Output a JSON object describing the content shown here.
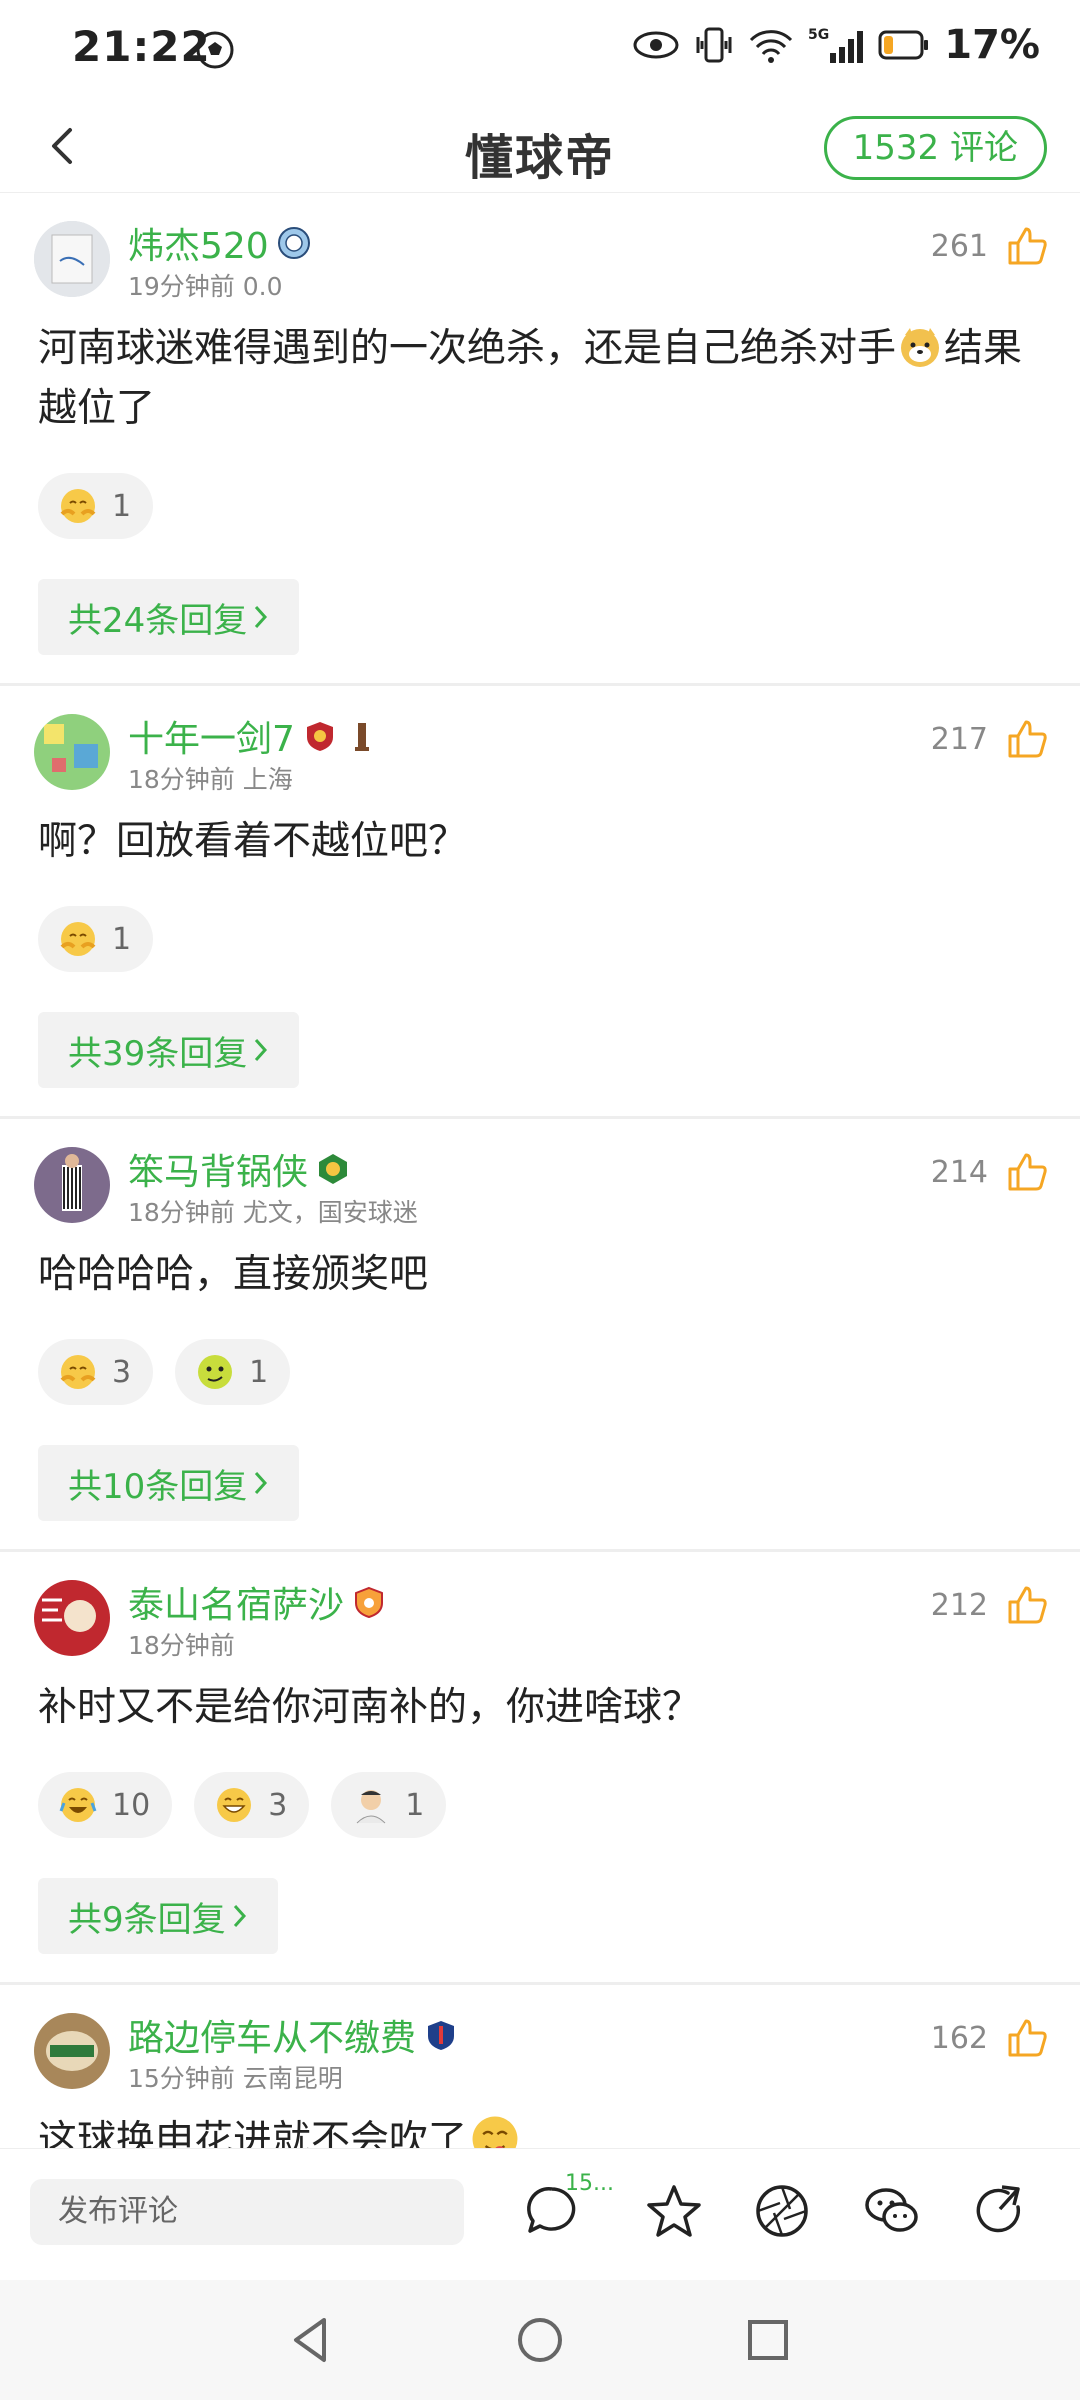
{
  "status_bar": {
    "time": "21:22",
    "network": "5G",
    "battery": "17%"
  },
  "top_bar": {
    "title": "懂球帝",
    "comment_count": "1532 评论"
  },
  "comments": [
    {
      "username": "炜杰520",
      "meta": "19分钟前 0.0",
      "likes": "261",
      "text": "河南球迷难得遇到的一次绝杀，还是自己绝杀对手",
      "text_tail": "结果越位了",
      "reactions": [
        {
          "icon": "hug-emoji",
          "count": "1"
        }
      ],
      "reply_label": "共24条回复",
      "avatar_color": "#d9dde2",
      "badge_icon": "manchester-city-badge"
    },
    {
      "username": "十年一剑7",
      "meta": "18分钟前 上海",
      "likes": "217",
      "text": "啊？回放看着不越位吧？",
      "reactions": [
        {
          "icon": "hug-emoji",
          "count": "1"
        }
      ],
      "reply_label": "共39条回复",
      "avatar_color": "#7cc46b",
      "badge_icon": "club-shield-badge"
    },
    {
      "username": "笨马背锅侠",
      "meta": "18分钟前 尤文，国安球迷",
      "likes": "214",
      "text": "哈哈哈哈，直接颁奖吧",
      "reactions": [
        {
          "icon": "hug-emoji",
          "count": "3"
        },
        {
          "icon": "smirk-emoji",
          "count": "1"
        }
      ],
      "reply_label": "共10条回复",
      "avatar_color": "#6b5b7a",
      "badge_icon": "guoan-badge"
    },
    {
      "username": "泰山名宿萨沙",
      "meta": "18分钟前",
      "likes": "212",
      "text": "补时又不是给你河南补的，你进啥球？",
      "reactions": [
        {
          "icon": "laugh-cry-emoji",
          "count": "10"
        },
        {
          "icon": "joy-emoji",
          "count": "3"
        },
        {
          "icon": "person-emoji",
          "count": "1"
        }
      ],
      "reply_label": "共9条回复",
      "avatar_color": "#c0282f",
      "badge_icon": "taishan-badge"
    },
    {
      "username": "路边停车从不缴费",
      "meta": "15分钟前 云南昆明",
      "likes": "162",
      "text": "这球换申花进就不会吹了",
      "reactions": [],
      "reply_label": "",
      "avatar_color": "#9a7b52",
      "badge_icon": "shenhua-badge"
    }
  ],
  "bottom_bar": {
    "input_placeholder": "发布评论",
    "comment_badge": "15..."
  }
}
